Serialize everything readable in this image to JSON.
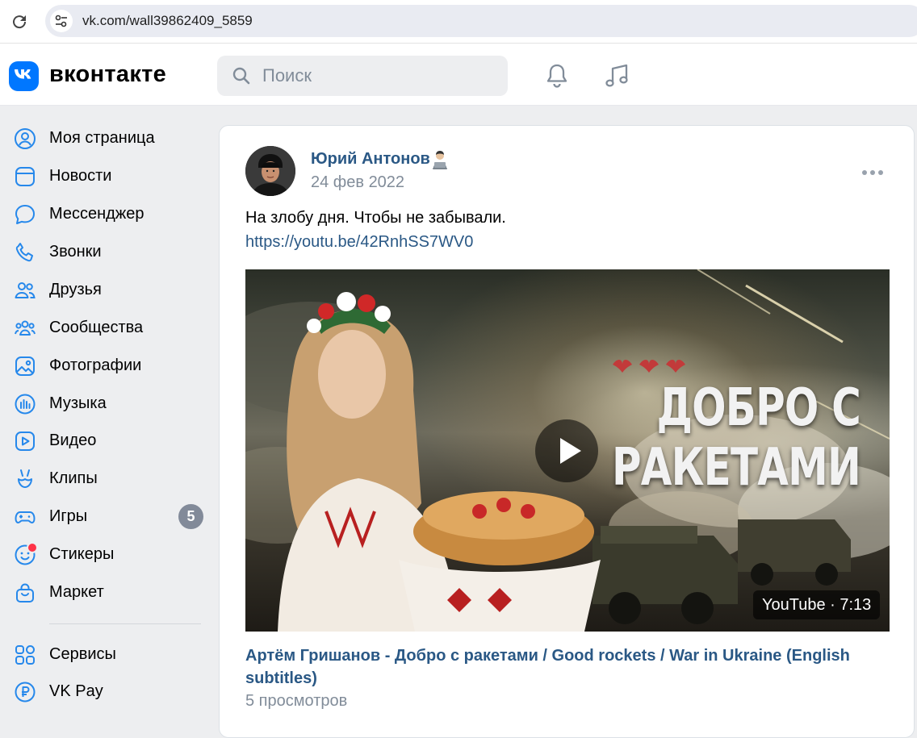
{
  "browser": {
    "url": "vk.com/wall39862409_5859"
  },
  "header": {
    "logo_text": "вконтакте",
    "search_placeholder": "Поиск",
    "icons": [
      "notifications-bell-icon",
      "music-note-icon"
    ]
  },
  "sidebar": {
    "items": [
      {
        "label": "Моя страница",
        "icon": "user-circle-icon"
      },
      {
        "label": "Новости",
        "icon": "news-icon"
      },
      {
        "label": "Мессенджер",
        "icon": "chat-bubble-icon"
      },
      {
        "label": "Звонки",
        "icon": "phone-icon"
      },
      {
        "label": "Друзья",
        "icon": "friends-icon"
      },
      {
        "label": "Сообщества",
        "icon": "communities-icon"
      },
      {
        "label": "Фотографии",
        "icon": "photo-icon"
      },
      {
        "label": "Музыка",
        "icon": "music-bars-icon"
      },
      {
        "label": "Видео",
        "icon": "video-play-icon"
      },
      {
        "label": "Клипы",
        "icon": "clips-icon"
      },
      {
        "label": "Игры",
        "icon": "gamepad-icon",
        "badge": "5"
      },
      {
        "label": "Стикеры",
        "icon": "sticker-smile-icon"
      },
      {
        "label": "Маркет",
        "icon": "shopping-bag-icon"
      },
      {
        "label": "Сервисы",
        "icon": "services-grid-icon"
      },
      {
        "label": "VK Pay",
        "icon": "ruble-coin-icon"
      }
    ]
  },
  "post": {
    "author": "Юрий Антонов",
    "date": "24 фев 2022",
    "text": "На злобу дня. Чтобы не забывали.",
    "link": "https://youtu.be/42RnhSS7WV0",
    "video": {
      "title_overlay": "ДОБРО С РАКЕТАМИ",
      "duration": "YouTube · 7:13",
      "caption": "Артём Гришанов - Добро с ракетами / Good rockets / War in Ukraine (English subtitles)",
      "views": "5 просмотров"
    }
  },
  "colors": {
    "vk_blue": "#0077ff",
    "link": "#2a5885",
    "secondary_text": "#818c99",
    "background": "#edeef0"
  }
}
